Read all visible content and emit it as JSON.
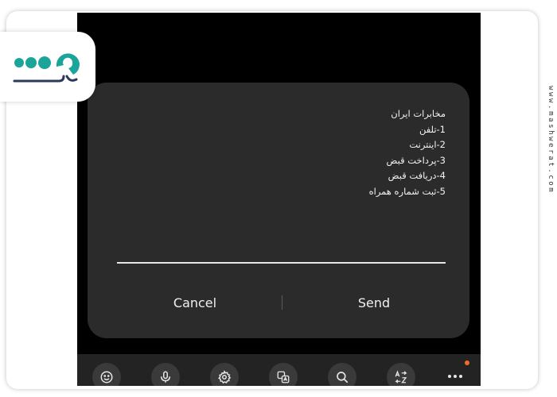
{
  "dialog": {
    "lines": [
      "مخابرات ایران",
      "1-تلفن",
      "2-اینترنت",
      "3-پرداخت قبض",
      "4-دریافت قبض",
      "5-ثبت شماره همراه"
    ],
    "cancel_label": "Cancel",
    "send_label": "Send"
  },
  "toolbar": {
    "icons": [
      "emoji-icon",
      "microphone-icon",
      "settings-icon",
      "translate-icon",
      "search-icon",
      "text-transform-icon",
      "more-icon"
    ]
  },
  "logo": {
    "text": "مشورت"
  },
  "side_url": "www.mashwerat.com",
  "colors": {
    "dialog_bg": "#2b2b2b",
    "screen_bg": "#000000",
    "logo_teal": "#1ba59a",
    "notification_dot": "#f26a2e"
  }
}
